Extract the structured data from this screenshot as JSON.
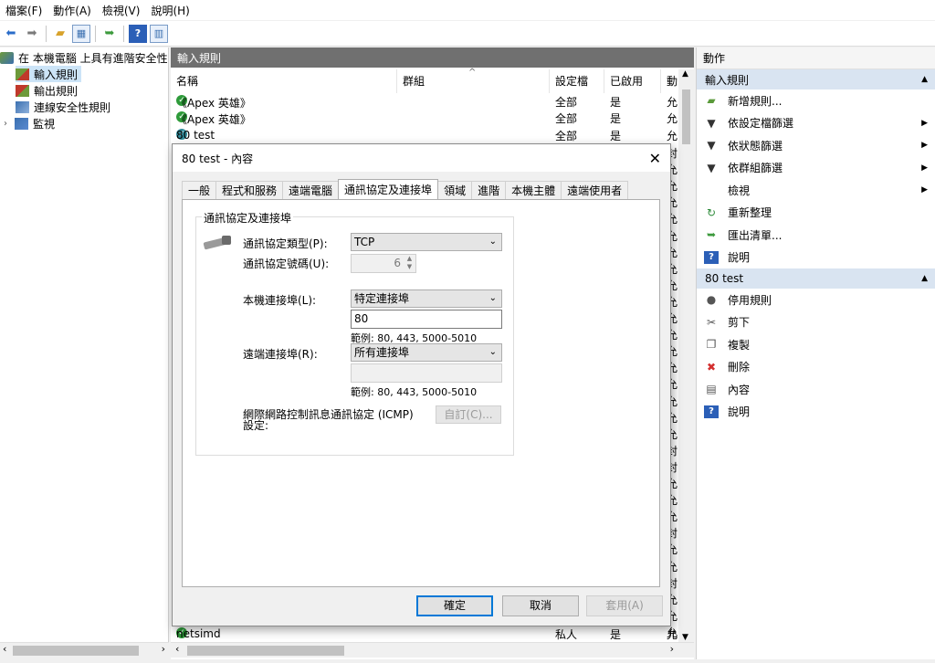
{
  "menu": [
    "檔案(F)",
    "動作(A)",
    "檢視(V)",
    "說明(H)"
  ],
  "tree": {
    "root": "在 本機電腦 上具有進階安全性",
    "items": [
      "輸入規則",
      "輸出規則",
      "連線安全性規則",
      "監視"
    ]
  },
  "center": {
    "title": "輸入規則",
    "columns": [
      "名稱",
      "群組",
      "設定檔",
      "已啟用",
      "動"
    ],
    "rows": [
      {
        "name": "《Apex 英雄》",
        "profile": "全部",
        "enabled": "是",
        "action": "允"
      },
      {
        "name": "《Apex 英雄》",
        "profile": "全部",
        "enabled": "是",
        "action": "允"
      },
      {
        "name": "80 test",
        "profile": "全部",
        "enabled": "是",
        "action": "允"
      }
    ],
    "side_chars": [
      "封",
      "允",
      "允",
      "允",
      "允",
      "允",
      "允",
      "允",
      "允",
      "允",
      "允",
      "允",
      "允",
      "允",
      "允",
      "允",
      "允",
      "允",
      "封",
      "封",
      "允",
      "允",
      "允",
      "封",
      "允",
      "允",
      "封",
      "允",
      "允",
      "允"
    ],
    "last_row": {
      "name": "netsimd",
      "profile": "私人",
      "enabled": "是",
      "action": "允"
    }
  },
  "actions": {
    "title": "動作",
    "section1": "輸入規則",
    "items1": [
      {
        "label": "新增規則...",
        "icon": "new-rule-icon"
      },
      {
        "label": "依設定檔篩選",
        "icon": "filter-icon",
        "submenu": true
      },
      {
        "label": "依狀態篩選",
        "icon": "filter-icon",
        "submenu": true
      },
      {
        "label": "依群組篩選",
        "icon": "filter-icon",
        "submenu": true
      },
      {
        "label": "檢視",
        "icon": "",
        "submenu": true
      },
      {
        "label": "重新整理",
        "icon": "refresh-icon"
      },
      {
        "label": "匯出清單...",
        "icon": "export-icon"
      },
      {
        "label": "說明",
        "icon": "help-icon"
      }
    ],
    "section2": "80 test",
    "items2": [
      {
        "label": "停用規則",
        "icon": "disable-icon"
      },
      {
        "label": "剪下",
        "icon": "cut-icon"
      },
      {
        "label": "複製",
        "icon": "copy-icon"
      },
      {
        "label": "刪除",
        "icon": "delete-icon"
      },
      {
        "label": "內容",
        "icon": "properties-icon"
      },
      {
        "label": "說明",
        "icon": "help-icon"
      }
    ]
  },
  "dialog": {
    "title": "80 test - 內容",
    "tabs": [
      "一般",
      "程式和服務",
      "遠端電腦",
      "通訊協定及連接埠",
      "領域",
      "進階",
      "本機主體",
      "遠端使用者"
    ],
    "active_tab": "通訊協定及連接埠",
    "group_label": "通訊協定及連接埠",
    "protocol_type_label": "通訊協定類型(P):",
    "protocol_type_value": "TCP",
    "protocol_number_label": "通訊協定號碼(U):",
    "protocol_number_value": "6",
    "local_port_label": "本機連接埠(L):",
    "local_port_value": "特定連接埠",
    "local_port_input": "80",
    "local_example": "範例: 80, 443, 5000-5010",
    "remote_port_label": "遠端連接埠(R):",
    "remote_port_value": "所有連接埠",
    "remote_port_input": "",
    "remote_example": "範例: 80, 443, 5000-5010",
    "icmp_label_1": "網際網路控制訊息通訊協定 (ICMP)",
    "icmp_label_2": "設定:",
    "customize_button": "自訂(C)...",
    "ok_button": "確定",
    "cancel_button": "取消",
    "apply_button": "套用(A)"
  }
}
